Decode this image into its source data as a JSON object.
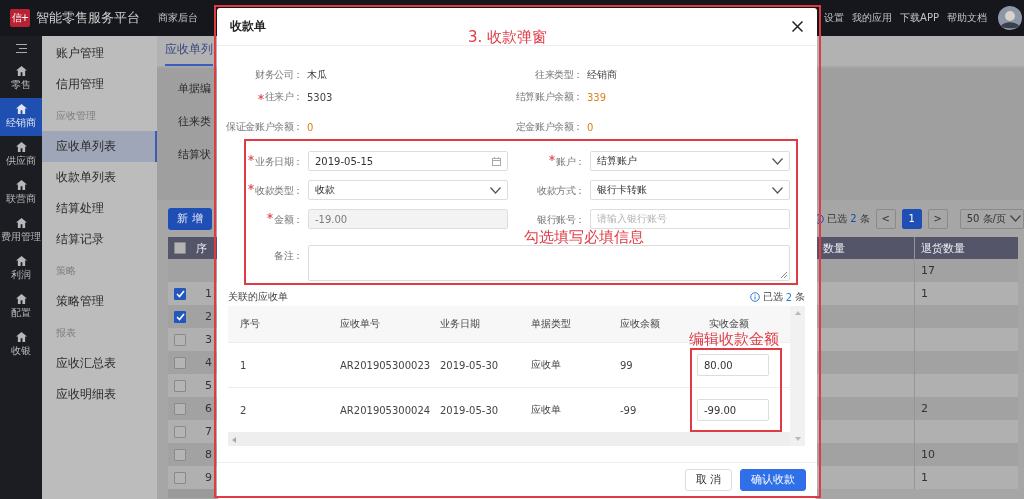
{
  "topbar": {
    "logo": "信+",
    "title": "智能零售服务平台",
    "nav": [
      "商家后台"
    ],
    "links": [
      "设置",
      "我的应用",
      "下载APP",
      "帮助文档"
    ]
  },
  "sidebar": {
    "items": [
      {
        "label": "零售",
        "selected": false
      },
      {
        "label": "经销商",
        "selected": true
      },
      {
        "label": "供应商",
        "selected": false
      },
      {
        "label": "联营商",
        "selected": false
      },
      {
        "label": "费用管理",
        "selected": false
      },
      {
        "label": "利润",
        "selected": false
      },
      {
        "label": "配置",
        "selected": false
      },
      {
        "label": "收银",
        "selected": false
      }
    ]
  },
  "submenu": {
    "items": [
      {
        "kind": "item",
        "label": "账户管理",
        "selected": false
      },
      {
        "kind": "item",
        "label": "信用管理",
        "selected": false
      },
      {
        "kind": "group",
        "label": "应收管理"
      },
      {
        "kind": "item",
        "label": "应收单列表",
        "selected": true
      },
      {
        "kind": "item",
        "label": "收款单列表",
        "selected": false
      },
      {
        "kind": "item",
        "label": "结算处理",
        "selected": false
      },
      {
        "kind": "item",
        "label": "结算记录",
        "selected": false
      },
      {
        "kind": "group",
        "label": "策略"
      },
      {
        "kind": "item",
        "label": "策略管理",
        "selected": false
      },
      {
        "kind": "group",
        "label": "报表"
      },
      {
        "kind": "item",
        "label": "应收汇总表",
        "selected": false
      },
      {
        "kind": "item",
        "label": "应收明细表",
        "selected": false
      }
    ]
  },
  "main": {
    "tab": "应收单列",
    "filters": [
      "单据编",
      "往来类",
      "结算状"
    ],
    "add_button": "新 增",
    "selection": {
      "prefix": "已选",
      "count": "2",
      "suffix": "条"
    },
    "pagination": {
      "prev": "<",
      "pages": [
        {
          "label": "1",
          "selected": true
        }
      ],
      "next": ">",
      "page_size": "50 条/页"
    },
    "table": {
      "header_checked": false,
      "columns": [
        "序",
        "数量",
        "退货数量"
      ],
      "rows": [
        {
          "kind": "summary",
          "column_3": "17"
        },
        {
          "kind": "item",
          "checked": true,
          "index": "1",
          "column_3": "1"
        },
        {
          "kind": "item",
          "checked": true,
          "index": "2"
        },
        {
          "kind": "item",
          "checked": false,
          "index": "3"
        },
        {
          "kind": "item",
          "checked": false,
          "index": "4"
        },
        {
          "kind": "item",
          "checked": false,
          "index": "5"
        },
        {
          "kind": "item",
          "checked": false,
          "index": "6",
          "column_3": "2"
        },
        {
          "kind": "item",
          "checked": false,
          "index": "7"
        },
        {
          "kind": "item",
          "checked": false,
          "index": "8",
          "column_3": "10"
        },
        {
          "kind": "item",
          "checked": false,
          "index": "9",
          "column_3": "1"
        }
      ]
    }
  },
  "modal": {
    "title": "收款单",
    "info": [
      {
        "label": "财务公司：",
        "value": "木瓜",
        "required": false,
        "highlight": false
      },
      {
        "label": "往来类型：",
        "value": "经销商",
        "required": false,
        "highlight": false
      },
      {
        "label": "往来户：",
        "value": "5303",
        "required": true,
        "highlight": false
      },
      {
        "label": "结算账户余额：",
        "value": "339",
        "required": false,
        "highlight": true
      },
      {
        "label": "保证金账户余额：",
        "value": "0",
        "required": false,
        "highlight": true
      },
      {
        "label": "定金账户余额：",
        "value": "0",
        "required": false,
        "highlight": true
      }
    ],
    "fields": [
      {
        "kind": "date",
        "label": "业务日期：",
        "required": true,
        "disabled": false,
        "value": "2019-05-15"
      },
      {
        "kind": "select",
        "label": "账户：",
        "required": true,
        "disabled": false,
        "value": "结算账户"
      },
      {
        "kind": "select",
        "label": "收款类型：",
        "required": true,
        "disabled": false,
        "value": "收款"
      },
      {
        "kind": "select",
        "label": "收款方式：",
        "required": false,
        "disabled": false,
        "value": "银行卡转账"
      },
      {
        "kind": "text",
        "label": "金额：",
        "required": true,
        "disabled": true,
        "value": "-19.00"
      },
      {
        "kind": "text",
        "label": "银行账号：",
        "required": false,
        "disabled": false,
        "placeholder": "请输入银行账号"
      },
      {
        "kind": "textarea",
        "label": "备注：",
        "required": false,
        "disabled": false
      }
    ],
    "related": {
      "title": "关联的应收单",
      "selection": {
        "prefix": "已选",
        "count": "2",
        "suffix": "条"
      },
      "columns": [
        "序号",
        "应收单号",
        "业务日期",
        "单据类型",
        "应收余额",
        "实收金额"
      ],
      "rows": [
        {
          "index": "1",
          "number": "AR201905300023",
          "date": "2019-05-30",
          "type": "应收单",
          "balance": "99",
          "amount": "80.00"
        },
        {
          "index": "2",
          "number": "AR201905300024",
          "date": "2019-05-30",
          "type": "应收单",
          "balance": "-99",
          "amount": "-99.00"
        }
      ]
    },
    "buttons": [
      {
        "kind": "secondary",
        "label": "取 消"
      },
      {
        "kind": "primary",
        "label": "确认收款"
      }
    ]
  },
  "annotations": [
    {
      "kind": "modal",
      "text": "3. 收款弹窗"
    },
    {
      "kind": "form",
      "text": "勾选填写必填信息"
    },
    {
      "kind": "amount",
      "text": "编辑收款金额"
    }
  ]
}
